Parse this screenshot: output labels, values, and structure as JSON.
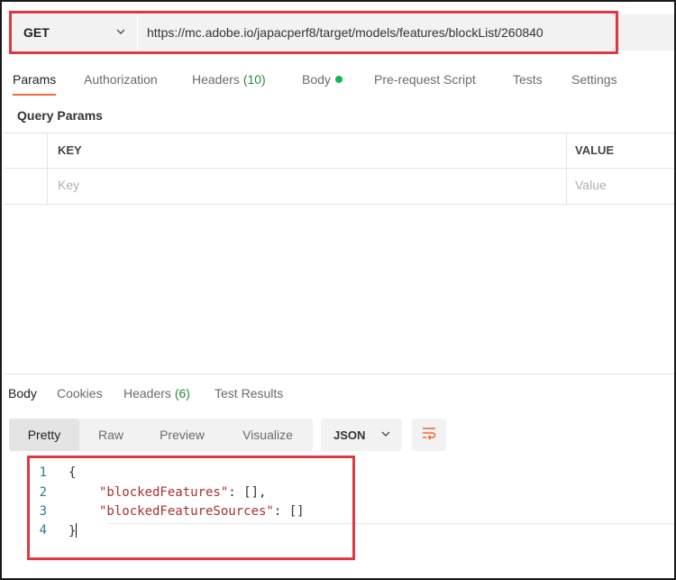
{
  "request": {
    "method": "GET",
    "url": "https://mc.adobe.io/japacperf8/target/models/features/blockList/260840"
  },
  "request_tabs": [
    {
      "label": "Params",
      "active": true
    },
    {
      "label": "Authorization"
    },
    {
      "label": "Headers",
      "count": "(10)"
    },
    {
      "label": "Body",
      "has_indicator": true
    },
    {
      "label": "Pre-request Script"
    },
    {
      "label": "Tests"
    },
    {
      "label": "Settings"
    }
  ],
  "query_params": {
    "title": "Query Params",
    "columns": [
      "KEY",
      "VALUE"
    ],
    "placeholders": {
      "key": "Key",
      "value": "Value"
    }
  },
  "response_tabs": [
    {
      "label": "Body",
      "active": true
    },
    {
      "label": "Cookies"
    },
    {
      "label": "Headers",
      "count": "(6)"
    },
    {
      "label": "Test Results"
    }
  ],
  "view_modes": [
    "Pretty",
    "Raw",
    "Preview",
    "Visualize"
  ],
  "active_view": "Pretty",
  "format": "JSON",
  "response_body": [
    {
      "n": "1",
      "text": "{"
    },
    {
      "n": "2",
      "key": "\"blockedFeatures\"",
      "rest": ": [],"
    },
    {
      "n": "3",
      "key": "\"blockedFeatureSources\"",
      "rest": ": []"
    },
    {
      "n": "4",
      "text": "}"
    }
  ],
  "colors": {
    "accent": "#f26b3a",
    "highlight": "#e0383e",
    "indicator": "#0cbb52",
    "json_key": "#a83232"
  },
  "icons": [
    "chevron-down-icon",
    "wrap-lines-icon"
  ]
}
